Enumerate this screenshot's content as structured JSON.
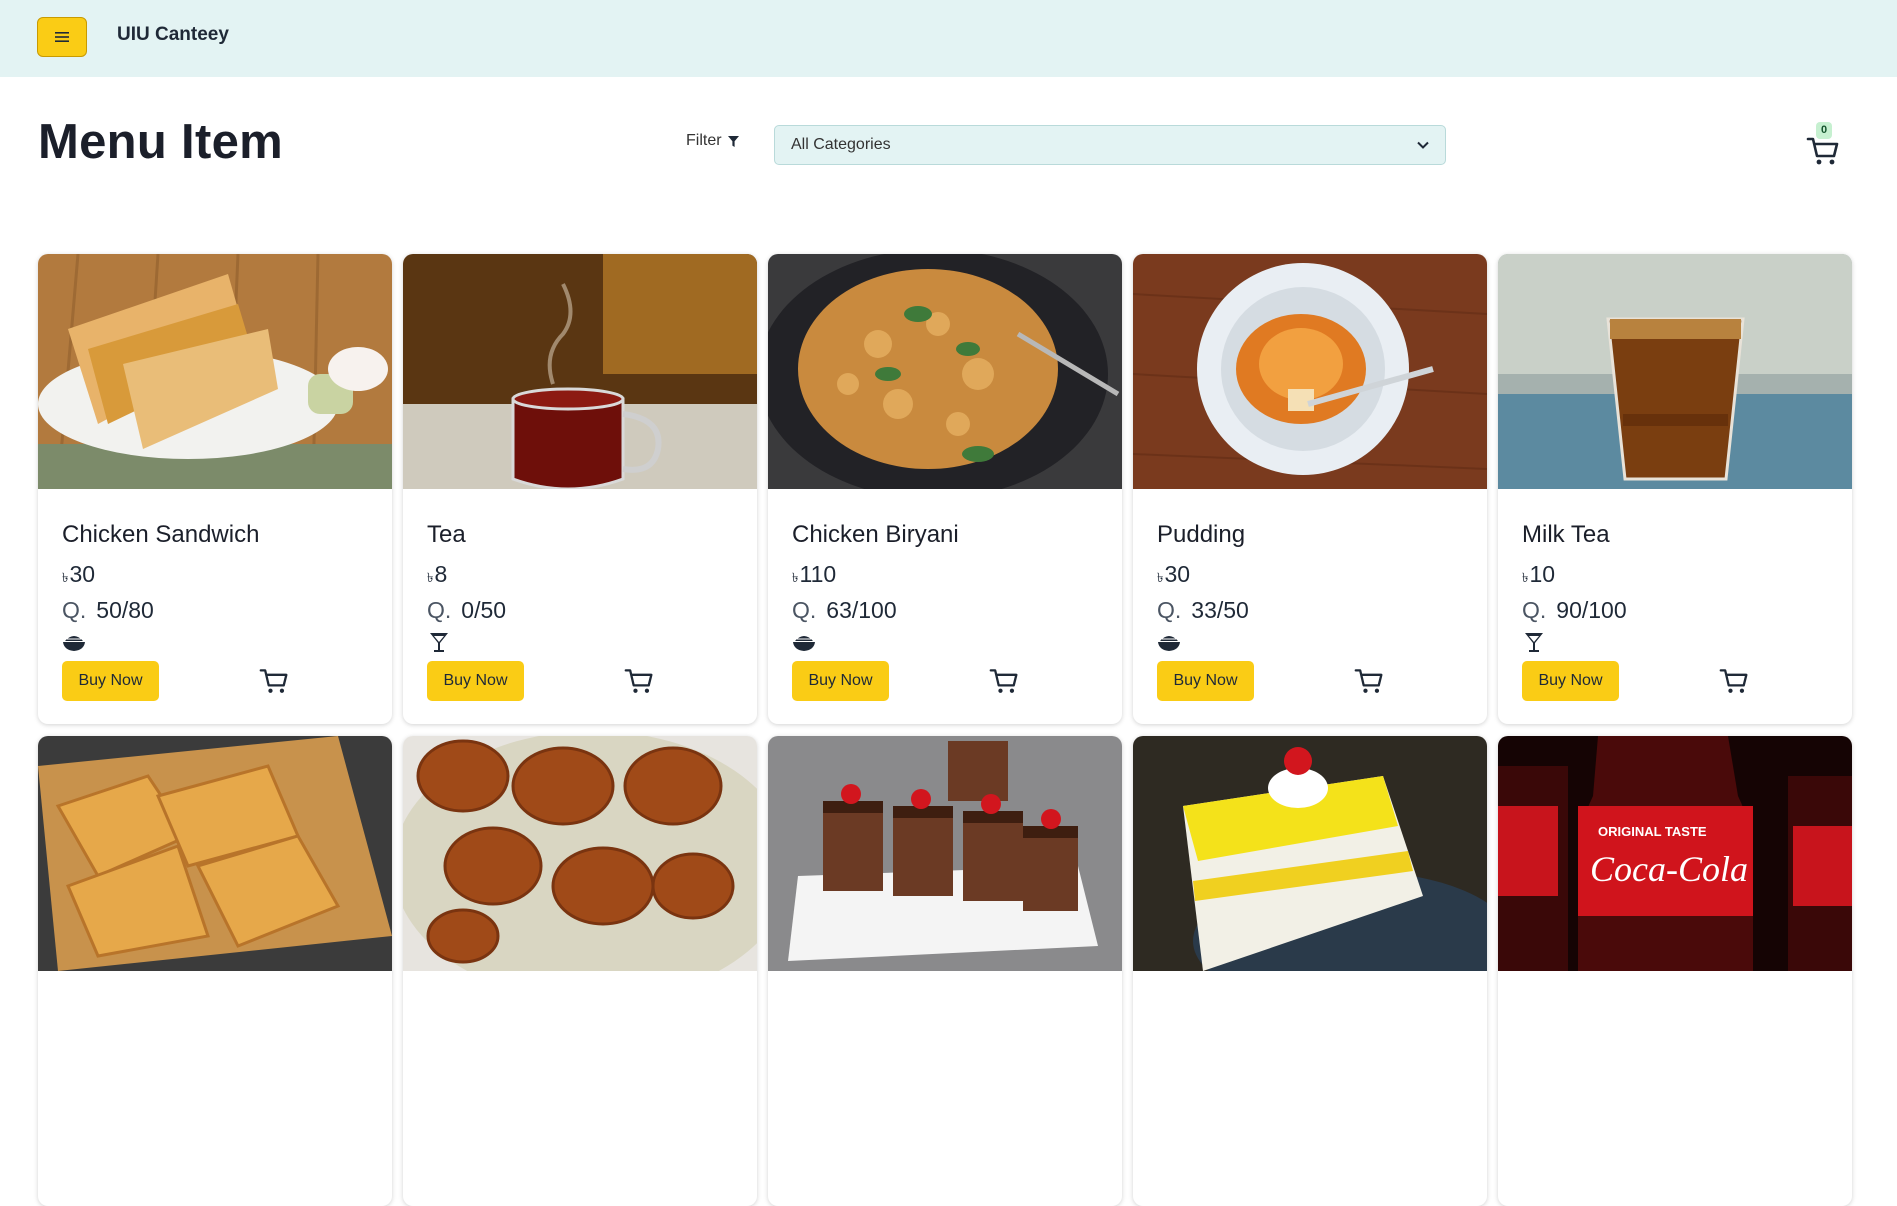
{
  "header": {
    "app_title": "UIU Canteey"
  },
  "page": {
    "title": "Menu Item",
    "filter_label": "Filter",
    "category_select": {
      "selected": "All Categories"
    },
    "cart_count": "0"
  },
  "currency_symbol": "৳",
  "quantity_label": "Q.",
  "buy_label": "Buy Now",
  "items": [
    {
      "name": "Chicken Sandwich",
      "price": "30",
      "quantity": "50/80",
      "category_icon": "food-bowl-icon",
      "image": "chicken-sandwich-photo"
    },
    {
      "name": "Tea",
      "price": "8",
      "quantity": "0/50",
      "category_icon": "cocktail-glass-icon",
      "image": "tea-photo"
    },
    {
      "name": "Chicken Biryani",
      "price": "110",
      "quantity": "63/100",
      "category_icon": "food-bowl-icon",
      "image": "chicken-biryani-photo"
    },
    {
      "name": "Pudding",
      "price": "30",
      "quantity": "33/50",
      "category_icon": "food-bowl-icon",
      "image": "pudding-photo"
    },
    {
      "name": "Milk Tea",
      "price": "10",
      "quantity": "90/100",
      "category_icon": "cocktail-glass-icon",
      "image": "milk-tea-photo"
    },
    {
      "image": "pastry-patties-photo"
    },
    {
      "image": "fried-chicken-photo"
    },
    {
      "image": "chocolate-cake-photo"
    },
    {
      "image": "pineapple-cake-photo"
    },
    {
      "image": "coca-cola-bottles-photo"
    }
  ],
  "colors": {
    "topbar_bg": "#e3f3f3",
    "accent_yellow": "#facc15",
    "badge_green": "#c6f0d0"
  }
}
